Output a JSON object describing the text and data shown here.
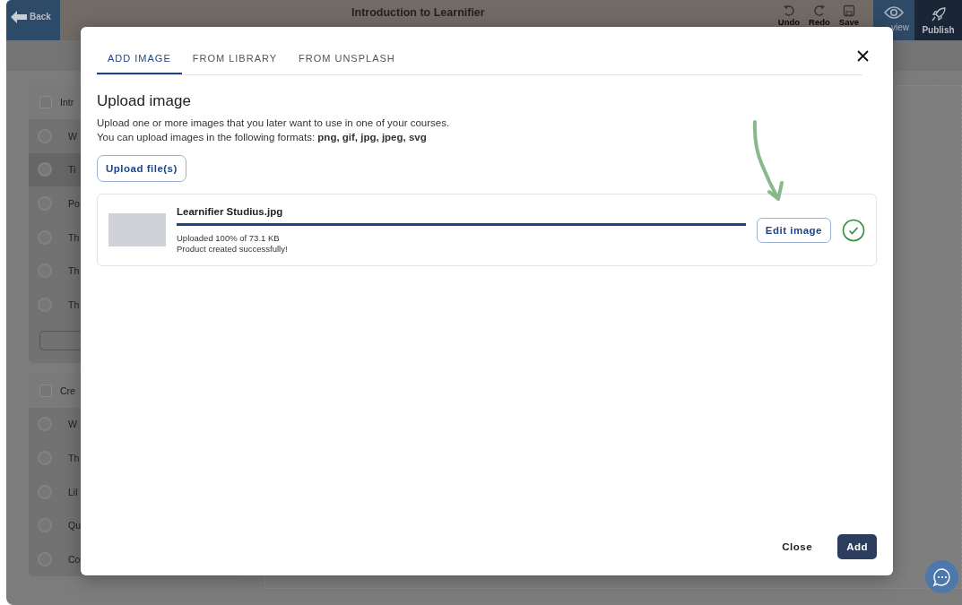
{
  "app_bar": {
    "back": "Back",
    "title": "Introduction to Learnifier",
    "actions": [
      {
        "label": "Undo",
        "kind": "undo"
      },
      {
        "label": "Redo",
        "kind": "redo"
      },
      {
        "label": "Save",
        "kind": "save"
      }
    ],
    "preview": "view",
    "publish": "Publish"
  },
  "outline": {
    "sections": [
      {
        "title": "Intr",
        "lessons": [
          {
            "title": "W",
            "selected": false
          },
          {
            "title": "Ti",
            "selected": true
          },
          {
            "title": "Po",
            "selected": false
          },
          {
            "title": "Th",
            "selected": false
          },
          {
            "title": "Th",
            "selected": false
          },
          {
            "title": "Th",
            "selected": false
          }
        ],
        "has_add_button": true
      },
      {
        "title": "Cre",
        "lessons": [
          {
            "title": "W",
            "selected": false
          },
          {
            "title": "Th",
            "selected": false
          },
          {
            "title": "Lil",
            "selected": false
          },
          {
            "title": "Qu",
            "selected": false
          },
          {
            "title": "Co",
            "selected": false
          }
        ],
        "has_add_button": false
      }
    ]
  },
  "dialog": {
    "tabs": [
      {
        "label": "ADD IMAGE",
        "selected": true
      },
      {
        "label": "FROM LIBRARY",
        "selected": false
      },
      {
        "label": "FROM UNSPLASH",
        "selected": false
      }
    ],
    "heading": "Upload image",
    "description": [
      "Upload one or more images that you later want to use in one of your courses.",
      "You can upload images in the following formats: **png, gif, jpg, jpeg, svg**"
    ],
    "upload_button": "Upload file(s)",
    "files": [
      {
        "name": "Learnifier Studius.jpg",
        "level": 1,
        "status": "Uploaded 100% of 73.1 KB",
        "message": "Product created successfully!",
        "edit_button": "Edit image",
        "done": true
      }
    ],
    "close_button": "Close",
    "add_button": "Add"
  }
}
